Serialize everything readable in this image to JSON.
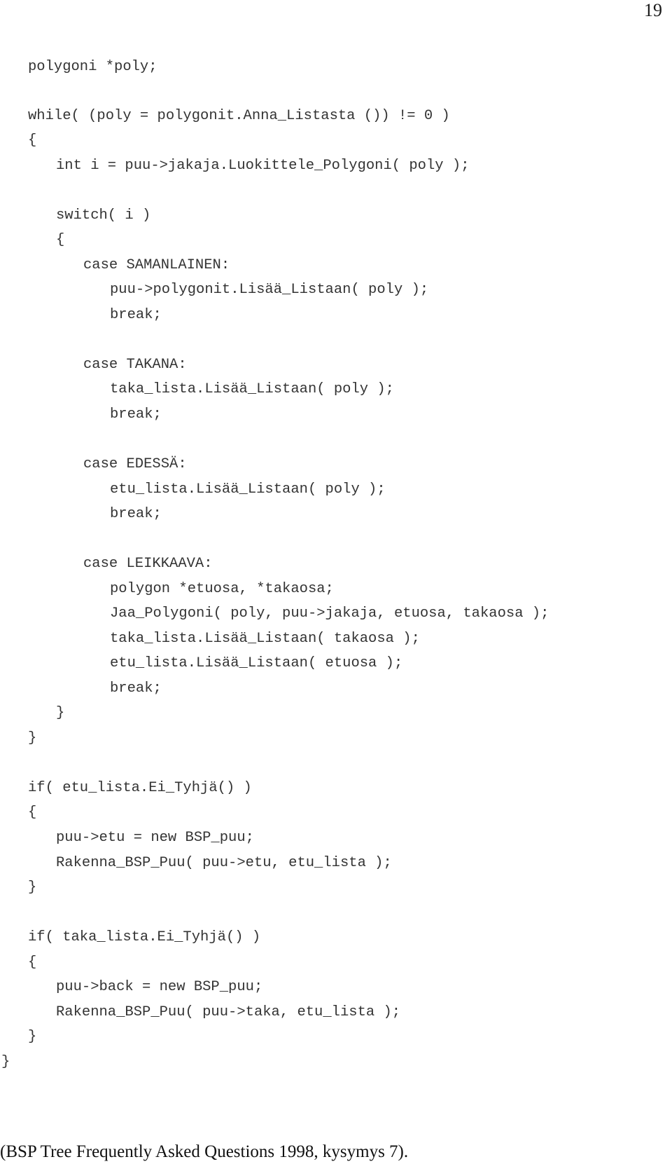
{
  "page": {
    "number": "19"
  },
  "code": {
    "lines": [
      {
        "indent": 1,
        "text": "polygoni *poly;"
      },
      {
        "indent": 1,
        "text": "while( (poly = polygonit.Anna_Listasta ()) != 0 )"
      },
      {
        "indent": 1,
        "text": "{"
      },
      {
        "indent": 2,
        "text": "int i = puu->jakaja.Luokittele_Polygoni( poly );"
      },
      {
        "indent": 2,
        "text": "switch( i )"
      },
      {
        "indent": 2,
        "text": "{"
      },
      {
        "indent": 3,
        "text": "case SAMANLAINEN:"
      },
      {
        "indent": 4,
        "text": "puu->polygonit.Lisää_Listaan( poly );"
      },
      {
        "indent": 4,
        "text": "break;"
      },
      {
        "indent": 3,
        "text": "case TAKANA:"
      },
      {
        "indent": 4,
        "text": "taka_lista.Lisää_Listaan( poly );"
      },
      {
        "indent": 4,
        "text": "break;"
      },
      {
        "indent": 3,
        "text": "case EDESSÄ:"
      },
      {
        "indent": 4,
        "text": "etu_lista.Lisää_Listaan( poly );"
      },
      {
        "indent": 4,
        "text": "break;"
      },
      {
        "indent": 3,
        "text": "case LEIKKAAVA:"
      },
      {
        "indent": 4,
        "text": "polygon *etuosa, *takaosa;"
      },
      {
        "indent": 4,
        "text": "Jaa_Polygoni( poly, puu->jakaja, etuosa, takaosa );"
      },
      {
        "indent": 4,
        "text": "taka_lista.Lisää_Listaan( takaosa );"
      },
      {
        "indent": 4,
        "text": "etu_lista.Lisää_Listaan( etuosa );"
      },
      {
        "indent": 4,
        "text": "break;"
      },
      {
        "indent": 2,
        "text": "}"
      },
      {
        "indent": 1,
        "text": "}"
      },
      {
        "indent": 1,
        "text": "if( etu_lista.Ei_Tyhjä() )"
      },
      {
        "indent": 1,
        "text": "{"
      },
      {
        "indent": 2,
        "text": "puu->etu = new BSP_puu;"
      },
      {
        "indent": 2,
        "text": "Rakenna_BSP_Puu( puu->etu, etu_lista );"
      },
      {
        "indent": 1,
        "text": "}"
      },
      {
        "indent": 1,
        "text": "if( taka_lista.Ei_Tyhjä() )"
      },
      {
        "indent": 1,
        "text": "{"
      },
      {
        "indent": 2,
        "text": "puu->back = new BSP_puu;"
      },
      {
        "indent": 2,
        "text": "Rakenna_BSP_Puu( puu->taka, etu_lista );"
      },
      {
        "indent": 1,
        "text": "}"
      },
      {
        "indent": 0,
        "text": "}"
      }
    ]
  },
  "caption": {
    "text": "(BSP Tree Frequently Asked Questions 1998, kysymys 7)."
  }
}
